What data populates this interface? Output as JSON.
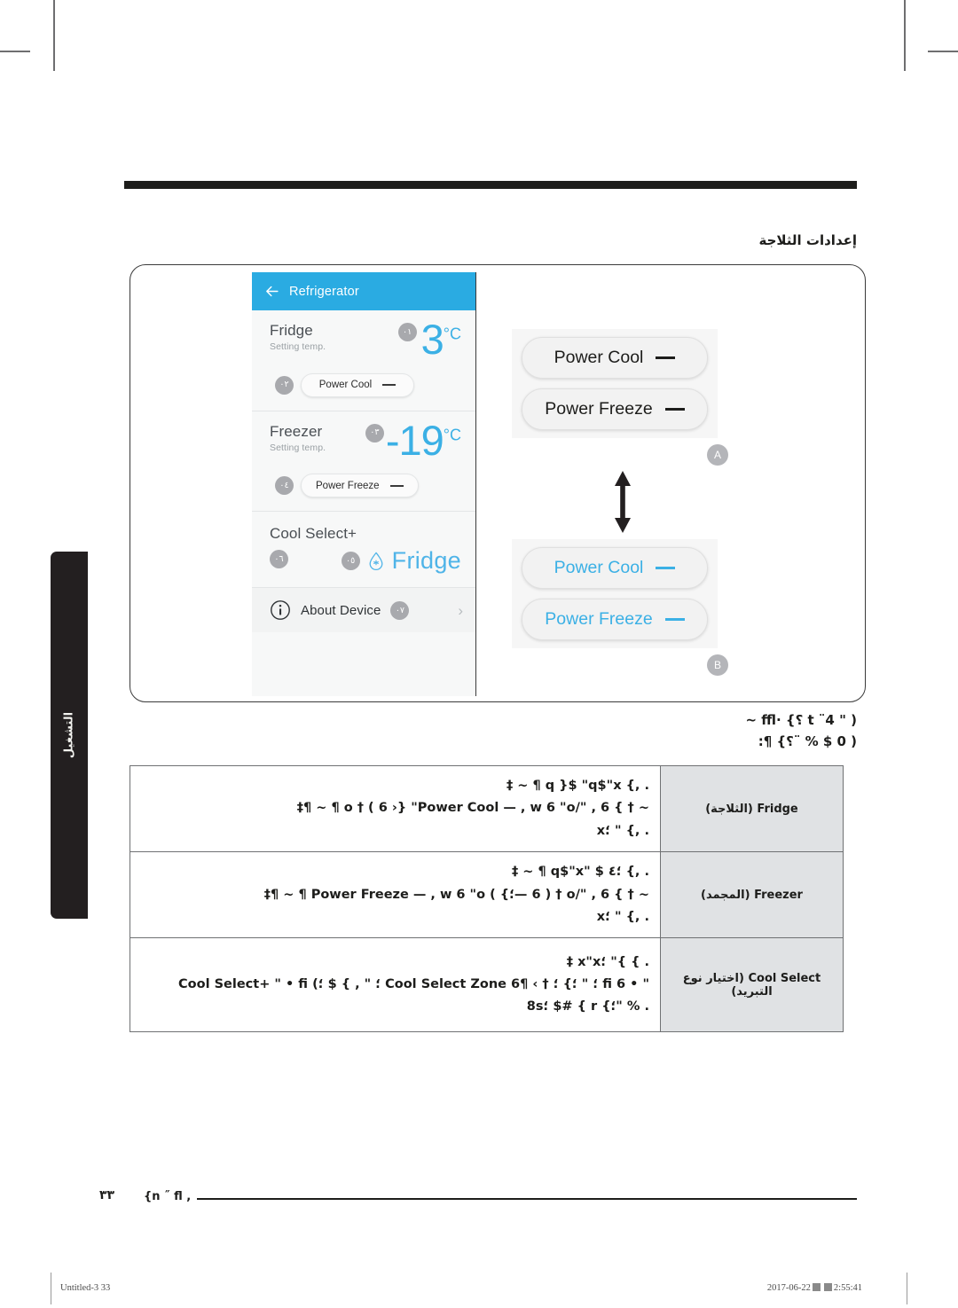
{
  "section_heading": "إعدادات الثلاجة",
  "phone": {
    "header": {
      "title": "Refrigerator",
      "back_icon": "back-arrow-icon",
      "bg_color": "#2aabe2"
    },
    "fridge": {
      "name": "Fridge",
      "subtitle": "Setting temp.",
      "temp_value": "3",
      "temp_unit": "°C",
      "badge_temp": "٠١",
      "badge_pill": "٠٢",
      "pill_label": "Power Cool"
    },
    "freezer": {
      "name": "Freezer",
      "subtitle": "Setting temp.",
      "temp_value": "-19",
      "temp_unit": "°C",
      "badge_temp": "٠٣",
      "badge_pill": "٠٤",
      "pill_label": "Power Freeze"
    },
    "cool_select": {
      "title": "Cool Select+",
      "badge_title": "٠٦",
      "badge_mode": "٠٥",
      "mode_label": "Fridge",
      "mode_icon": "water-drop-icon"
    },
    "about": {
      "label": "About Device",
      "badge": "٠٧",
      "info_icon": "info-circle-icon",
      "chevron_icon": "chevron-right-icon"
    }
  },
  "diagram": {
    "group_a": {
      "tag": "A",
      "buttons": [
        {
          "label": "Power Cool",
          "state": "off"
        },
        {
          "label": "Power Freeze",
          "state": "off"
        }
      ]
    },
    "group_b": {
      "tag": "B",
      "buttons": [
        {
          "label": "Power Cool",
          "state": "on"
        },
        {
          "label": "Power Freeze",
          "state": "on"
        }
      ]
    },
    "arrow_icon": "double-vertical-arrow-icon",
    "accent_on_color": "#3bb0e5",
    "accent_off_color": "#1d1d1b"
  },
  "notes": [
    "( \" t ¨4  ؟} ·ffl ~",
    "( 0 $ % ¨؟} ¶:"
  ],
  "table": {
    "rows": [
      {
        "label": "Fridge (الثلاجة)",
        "desc_lines": [
          ". ,}  q  }$ \"q$\"x ¶ ~ ‡",
          "~ †  } 6 , \"/o † ( 6 ›} \"Power Cool  — , w 6 \"o ¶ ~ ¶‡",
          ". ,}    \"  ؛x"
        ]
      },
      {
        "label": "Freezer (المجمد)",
        "desc_lines": [
          ". ,}  ؛٤ $ \"q$\"x ¶ ~ ‡",
          "~ †  } 6 , \"/o † ( 6 —؛}  ) Power Freeze  — , w 6 \"o ¶ ~ ¶‡",
          ". ,}    \"  ؛x"
        ]
      },
      {
        "label": "Cool Select (اختيار نوع التبريد)",
        "desc_lines": [
          ". }    }\"  ؛x\"x ‡",
          "\" • fi  6 ؛  \"  ؛} ؛  † › ¶Cool Select Zone  6 ؛  \"  , } $  ؛) Cool Select+  \" • fi",
          ". %  \"؛} r  } #$  ؛8s"
        ]
      }
    ]
  },
  "side_tab": {
    "label": "التشغيل"
  },
  "page_footer": {
    "number": "٣٣",
    "label": ", n ˝ fl}"
  },
  "print_strip": {
    "left": "Untitled-3   33",
    "right_date": "2017-06-22",
    "right_time": "2:55:41"
  }
}
